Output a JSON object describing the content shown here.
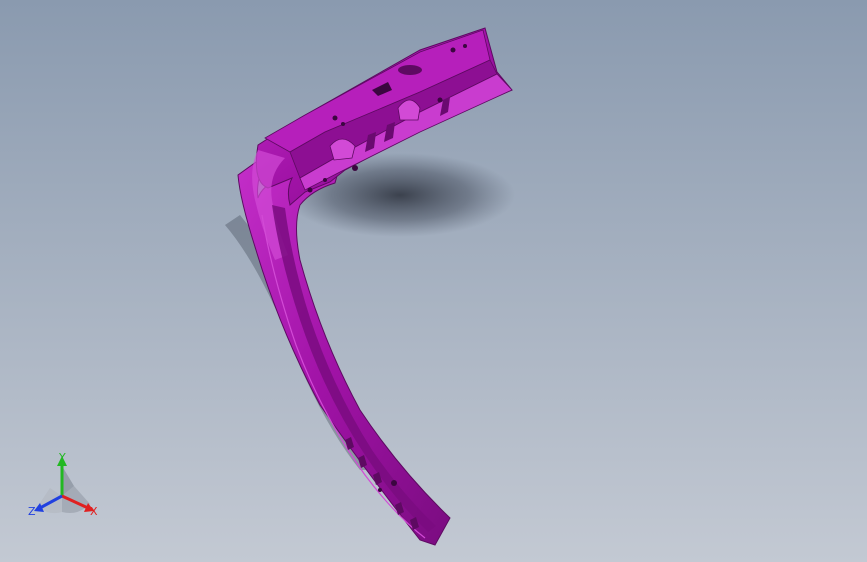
{
  "viewport": {
    "background_top": "#8a9aaf",
    "background_bottom": "#c3c9d3"
  },
  "model": {
    "part_color": "#a012a6",
    "highlight_color": "#d24ad6",
    "shadow_color": "#5e0a62"
  },
  "triad": {
    "x_label": "X",
    "y_label": "Y",
    "z_label": "Z",
    "x_color": "#e02020",
    "y_color": "#22b822",
    "z_color": "#2040e0"
  }
}
